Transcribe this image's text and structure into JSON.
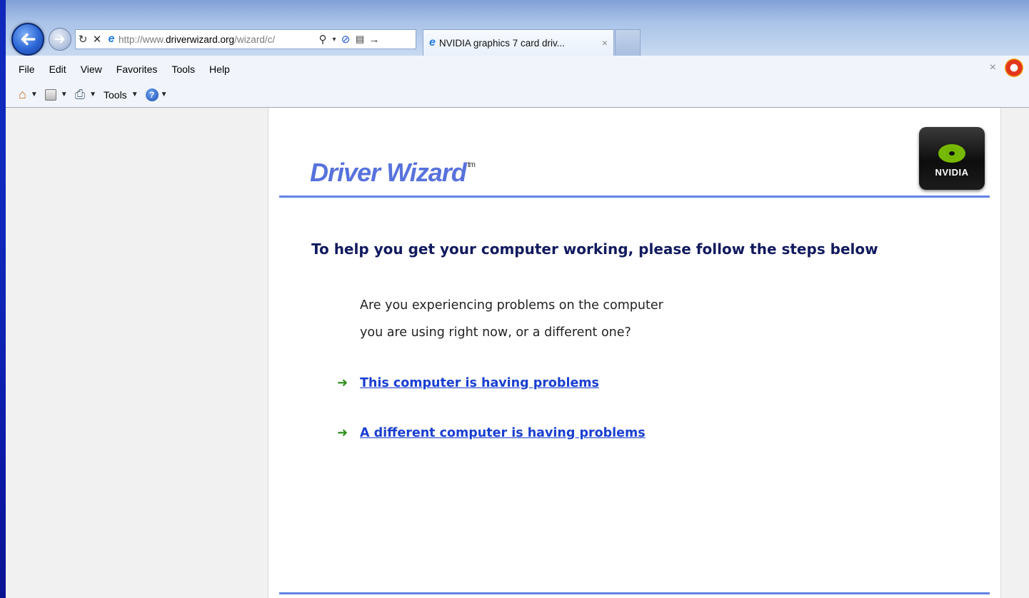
{
  "browser": {
    "address": {
      "url_prefix": "http://www.",
      "url_domain": "driverwizard.org",
      "url_path": "/wizard/c/"
    },
    "tab": {
      "title": "NVIDIA graphics 7 card driv...",
      "close": "×"
    },
    "menu": [
      "File",
      "Edit",
      "View",
      "Favorites",
      "Tools",
      "Help"
    ],
    "menubar_close": "×",
    "toolbar": {
      "tools_label": "Tools",
      "help_glyph": "?"
    }
  },
  "page": {
    "brand": "Driver Wizard",
    "trademark": "tm",
    "logo_text": "NVIDIA",
    "heading": "To help you get your computer working, please follow the steps below",
    "question_line1": "Are you experiencing problems on the computer",
    "question_line2": "you are using right now, or a different one?",
    "options": [
      {
        "arrow": "➜",
        "label": "This computer is having problems"
      },
      {
        "arrow": "➜",
        "label": "A different computer is having problems"
      }
    ]
  },
  "colors": {
    "brand": "#5872dc",
    "rule": "#6283e4",
    "heading": "#111a5e",
    "link": "#1a3fd0",
    "arrow": "#2f8f1c",
    "nvidia_green": "#76b900"
  },
  "icons": [
    "back-arrow-icon",
    "forward-arrow-icon",
    "refresh-icon",
    "stop-icon",
    "ie-icon",
    "search-icon",
    "block-icon",
    "compat-icon",
    "go-icon",
    "home-icon",
    "rss-icon",
    "print-icon",
    "help-icon",
    "addon-icon"
  ]
}
